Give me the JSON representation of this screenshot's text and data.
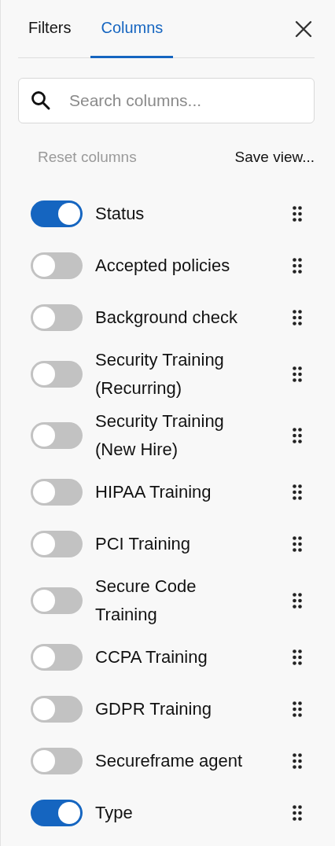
{
  "tabs": [
    {
      "label": "Filters",
      "selected": false
    },
    {
      "label": "Columns",
      "selected": true
    }
  ],
  "search": {
    "placeholder": "Search columns..."
  },
  "actions": [
    {
      "label": "Reset columns",
      "disabled": true
    },
    {
      "label": "Save view...",
      "disabled": false
    }
  ],
  "columns": [
    {
      "label": "Status",
      "on": true
    },
    {
      "label": "Accepted policies",
      "on": false
    },
    {
      "label": "Background check",
      "on": false
    },
    {
      "label": "Security Training (Recurring)",
      "on": false
    },
    {
      "label": "Security Training (New Hire)",
      "on": false
    },
    {
      "label": "HIPAA Training",
      "on": false
    },
    {
      "label": "PCI Training",
      "on": false
    },
    {
      "label": "Secure Code Training",
      "on": false
    },
    {
      "label": "CCPA Training",
      "on": false
    },
    {
      "label": "GDPR Training",
      "on": false
    },
    {
      "label": "Secureframe agent",
      "on": false
    },
    {
      "label": "Type",
      "on": true
    }
  ]
}
